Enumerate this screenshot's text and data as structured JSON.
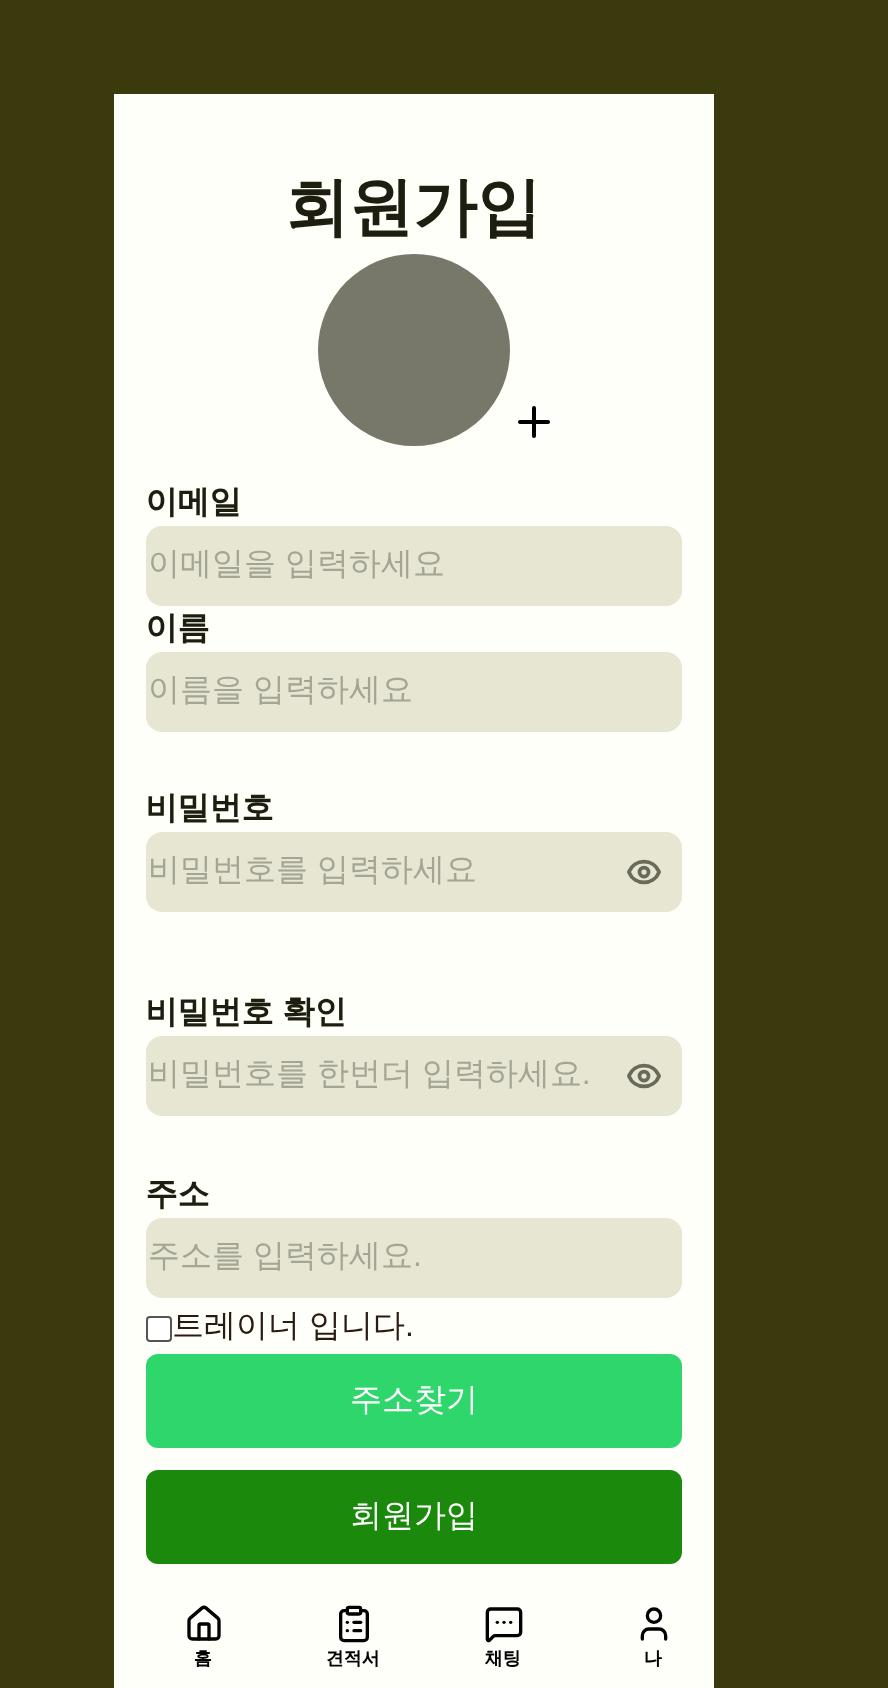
{
  "title": "회원가입",
  "fields": [
    {
      "label": "이메일",
      "placeholder": "이메일을 입력하세요",
      "kind": "text"
    },
    {
      "label": "이름",
      "placeholder": "이름을 입력하세요",
      "kind": "text"
    },
    {
      "label": "비밀번호",
      "placeholder": "비밀번호를 입력하세요",
      "kind": "password"
    },
    {
      "label": "비밀번호 확인",
      "placeholder": "비밀번호를 한번더 입력하세요.",
      "kind": "password"
    },
    {
      "label": "주소",
      "placeholder": "주소를 입력하세요.",
      "kind": "text"
    }
  ],
  "trainer_checkbox": {
    "label": "트레이너 입니다.",
    "checked": false
  },
  "buttons": [
    {
      "label": "주소찾기",
      "kind": "secondary"
    },
    {
      "label": "회원가입",
      "kind": "primary"
    }
  ],
  "bottom_nav": [
    {
      "label": "홈"
    },
    {
      "label": "견적서"
    },
    {
      "label": "채팅"
    },
    {
      "label": "나"
    }
  ]
}
